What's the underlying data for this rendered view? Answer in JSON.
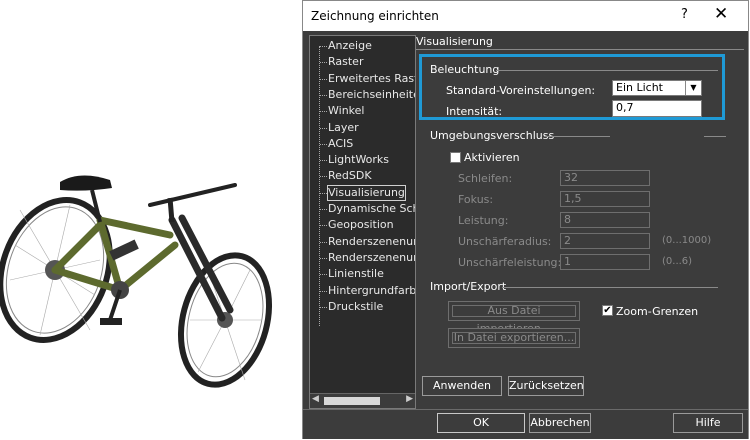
{
  "dialog": {
    "title": "Zeichnung einrichten",
    "help_glyph": "?",
    "close_glyph": "✕"
  },
  "tree": {
    "items": [
      "Anzeige",
      "Raster",
      "Erweitertes Raster",
      "Bereichseinheiten",
      "Winkel",
      "Layer",
      "ACIS",
      "LightWorks",
      "RedSDK",
      "Visualisierung",
      "Dynamische Schraffur",
      "Geoposition",
      "Renderszenenumgebung",
      "Renderszenenumgebungen",
      "Linienstile",
      "Hintergrundfarbe",
      "Druckstile"
    ],
    "selected_index": 9
  },
  "panel": {
    "header": "Visualisierung",
    "beleuchtung": {
      "title": "Beleuchtung",
      "preset_label": "Standard-Voreinstellungen:",
      "preset_value": "Ein Licht",
      "intensity_label": "Intensität:",
      "intensity_value": "0,7"
    },
    "ambient": {
      "title": "Umgebungsverschluss",
      "activate_label": "Aktivieren",
      "activate_checked": false,
      "fields": [
        {
          "label": "Schleifen:",
          "value": "32",
          "range": ""
        },
        {
          "label": "Fokus:",
          "value": "1,5",
          "range": ""
        },
        {
          "label": "Leistung:",
          "value": "8",
          "range": ""
        },
        {
          "label": "Unschärferadius:",
          "value": "2",
          "range": "(0...1000)"
        },
        {
          "label": "Unschärfeleistung:",
          "value": "1",
          "range": "(0...6)"
        }
      ]
    },
    "import_export": {
      "title": "Import/Export",
      "import_button": "Aus Datei importieren...",
      "export_button": "In Datei exportieren...",
      "zoom_label": "Zoom-Grenzen",
      "zoom_checked": true
    },
    "apply_button": "Anwenden",
    "reset_button": "Zurücksetzen"
  },
  "footer": {
    "ok": "OK",
    "cancel": "Abbrechen",
    "help": "Hilfe"
  },
  "colors": {
    "dialog_bg": "#3c3c3c",
    "highlight": "#1f9ad6"
  }
}
